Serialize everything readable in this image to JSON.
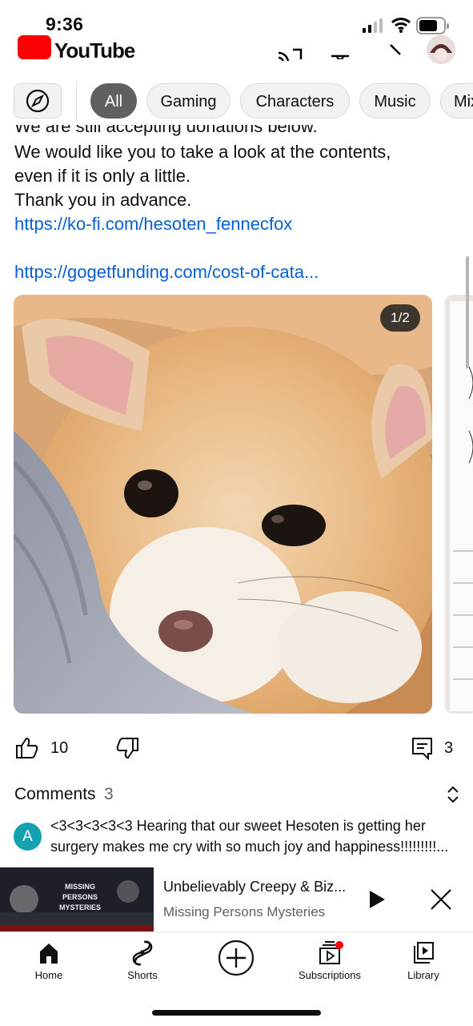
{
  "status_bar": {
    "time": "9:36"
  },
  "header": {
    "brand": "YouTube"
  },
  "chips": [
    "All",
    "Gaming",
    "Characters",
    "Music",
    "Mix"
  ],
  "post": {
    "partial_line": "We are still accepting donations below.",
    "lines": [
      "We would like you to take a look at the contents,",
      "even if it is only a little.",
      "Thank you in advance."
    ],
    "link1": "https://ko-fi.com/hesoten_fennecfox",
    "link2": "https://gogetfunding.com/cost-of-cata...",
    "image_counter": "1/2",
    "likes": "10",
    "comments_count": "3"
  },
  "comments": {
    "title": "Comments",
    "count": "3",
    "avatar_letter": "A",
    "first_line": "<3<3<3<3<3   Hearing that our sweet Hesoten is getting her",
    "second_line": "surgery makes me cry with so much joy and happiness!!!!!!!!!..."
  },
  "mini_player": {
    "title": "Unbelievably Creepy & Biz...",
    "channel": "Missing Persons Mysteries",
    "thumb_text": "MISSING PERSONS MYSTERIES"
  },
  "nav": {
    "home": "Home",
    "shorts": "Shorts",
    "subscriptions": "Subscriptions",
    "library": "Library"
  },
  "colors": {
    "accent": "#ff0000",
    "link": "#065fd4",
    "avatar": "#16a1b0"
  }
}
